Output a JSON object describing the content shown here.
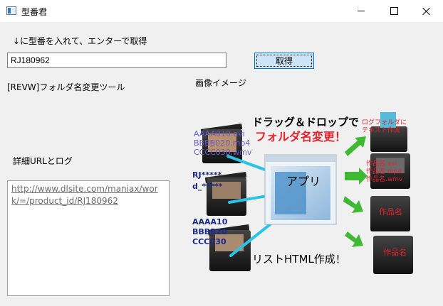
{
  "window": {
    "title": "型番君"
  },
  "instruction": "↓に型番を入れて、エンターで取得",
  "input": {
    "value": "RJ180962"
  },
  "fetch_button": "取得",
  "folder_tool_label": "[REVW]フォルダ名変更ツール",
  "image_label": "画像イメージ",
  "detail_label": "詳細URLとログ",
  "log_text": "http://www.dlsite.com/maniax/work/=/product_id/RJ180962",
  "diagram": {
    "drag_drop": "ドラッグ＆ドロップで",
    "rename": "フォルダ名変更！",
    "files": [
      "AAAA010.avi",
      "BBBB020.mp4",
      "CCCC030.wmv"
    ],
    "rj": "RJ*****",
    "d": "d_*****",
    "ids": [
      "AAAA10",
      "BBBB20",
      "CCCC30"
    ],
    "app": "アプリ",
    "log_folder": [
      "ログフォルダに",
      "テキスト作成"
    ],
    "work_names": [
      "作品名.avi",
      "作品名.mp4",
      "作品名.wmv"
    ],
    "work_folder_1": "作品名",
    "work_folder_2": "作品名",
    "list_html": "リストHTML作成！",
    "colors": {
      "red": "#e8202a",
      "blue": "#1a2a8c",
      "violet": "#6a5acd",
      "arrow": "#3fb934",
      "cyan": "#29c4e6"
    }
  }
}
